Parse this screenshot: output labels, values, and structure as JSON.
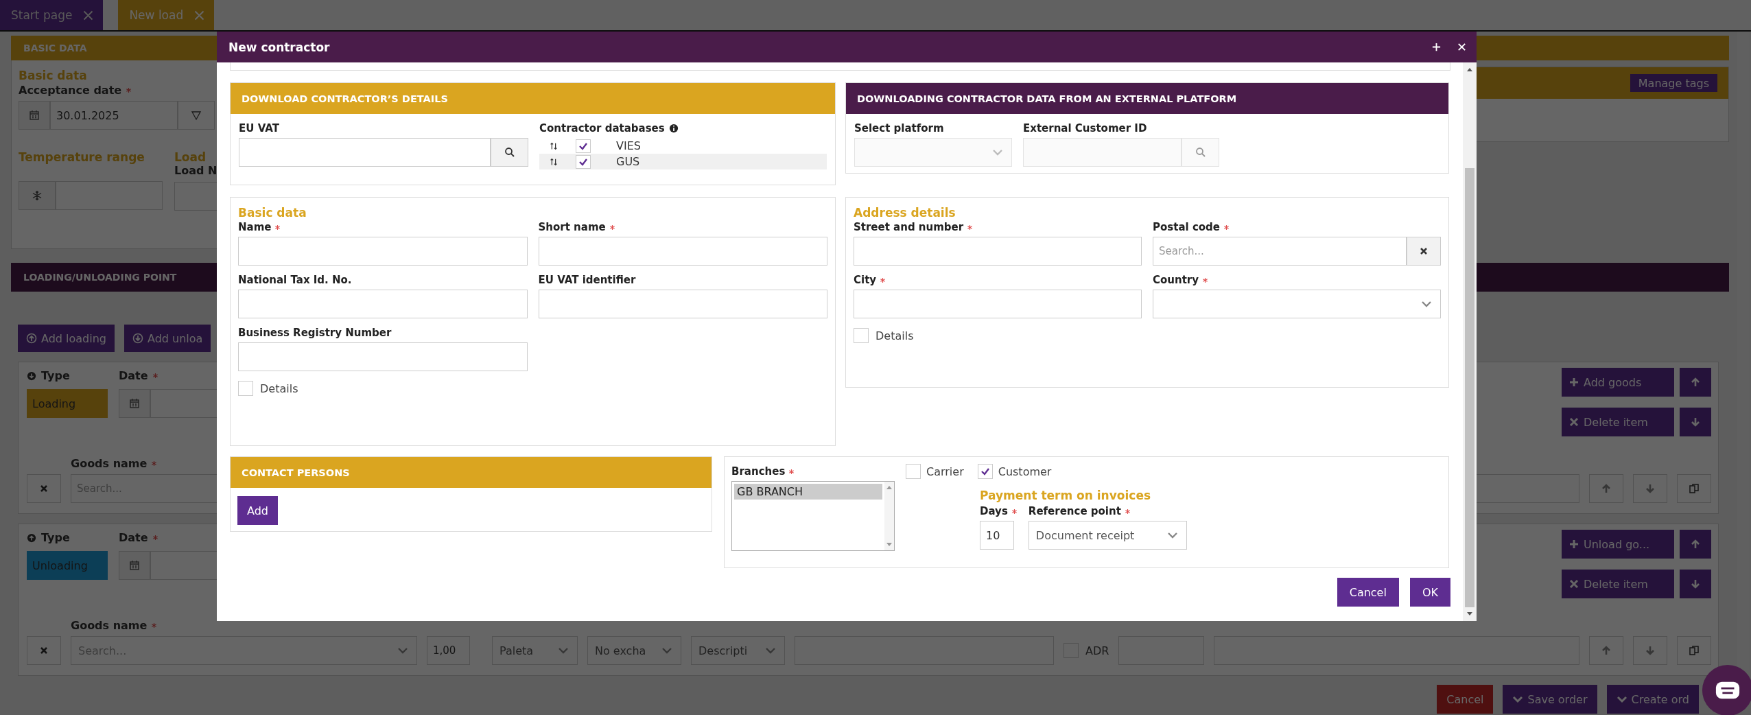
{
  "tabs": [
    {
      "label": "Start page",
      "selected": false
    },
    {
      "label": "New load",
      "selected": true
    }
  ],
  "basic_data_section": {
    "header": "BASIC DATA",
    "subtitle": "Basic data",
    "acceptance_label": "Acceptance date",
    "acceptance_required": true,
    "acceptance_value": "30.01.2025",
    "temperature_label": "Temperature range",
    "load_title": "Load",
    "load_label": "Load N",
    "manage_tags": "Manage tags"
  },
  "points_section": {
    "header": "LOADING/UNLOADING POINT",
    "add_buttons": [
      {
        "label": "Add loading",
        "kind": "loading"
      },
      {
        "label": "Add unloa",
        "kind": "unloading"
      }
    ],
    "items": [
      {
        "kind": "loading",
        "type_label": "Type",
        "type_value": "Loading",
        "date_label": "Date",
        "goods_label": "Goods name",
        "goods_placeholder": "Search...",
        "action_button": "Add goods",
        "delete_button": "Delete item"
      },
      {
        "kind": "unloading",
        "type_label": "Type",
        "type_value": "Unloading",
        "date_label": "Date",
        "goods_label": "Goods name",
        "goods_placeholder": "Search...",
        "action_button": "Unload go...",
        "delete_button": "Delete item",
        "quantity": "1,00",
        "unit": "Paleta",
        "exchange": "No excha",
        "description": "Descripti",
        "adr": {
          "label": "ADR",
          "checked": false
        }
      }
    ]
  },
  "footer_buttons": [
    {
      "label": "Cancel",
      "kind": "danger"
    },
    {
      "label": "Save order",
      "kind": "primary"
    },
    {
      "label": "Create ord",
      "kind": "primary"
    }
  ],
  "modal": {
    "title": "New contractor",
    "download_details": {
      "header": "DOWNLOAD CONTRACTOR’S DETAILS",
      "eu_vat_label": "EU VAT",
      "databases_label": "Contractor databases",
      "databases": [
        {
          "name": "VIES",
          "checked": true
        },
        {
          "name": "GUS",
          "checked": true
        }
      ]
    },
    "external_platform": {
      "header": "DOWNLOADING CONTRACTOR DATA FROM AN EXTERNAL PLATFORM",
      "platform_label": "Select platform",
      "customer_id_label": "External Customer ID"
    },
    "basic_data": {
      "title": "Basic data",
      "fields": [
        {
          "label": "Name",
          "required": true
        },
        {
          "label": "Short name",
          "required": true
        },
        {
          "label": "National Tax Id. No.",
          "required": false
        },
        {
          "label": "EU VAT identifier",
          "required": false
        },
        {
          "label": "Business Registry Number",
          "required": false
        }
      ],
      "details": {
        "label": "Details",
        "checked": false
      }
    },
    "address": {
      "title": "Address details",
      "fields": [
        {
          "label": "Street and number",
          "required": true,
          "kind": "text"
        },
        {
          "label": "Postal code",
          "required": true,
          "kind": "search",
          "placeholder": "Search..."
        },
        {
          "label": "City",
          "required": true,
          "kind": "text"
        },
        {
          "label": "Country",
          "required": true,
          "kind": "select"
        }
      ],
      "details": {
        "label": "Details",
        "checked": false
      }
    },
    "contact_persons": {
      "header": "CONTACT PERSONS",
      "add_button": "Add"
    },
    "branches": {
      "label": "Branches",
      "required": true,
      "options": [
        {
          "label": "GB BRANCH",
          "selected": true
        }
      ]
    },
    "roles": [
      {
        "label": "Carrier",
        "checked": false
      },
      {
        "label": "Customer",
        "checked": true
      }
    ],
    "payment_term": {
      "title": "Payment term on invoices",
      "days_label": "Days",
      "days_required": true,
      "days_value": "10",
      "reference_label": "Reference point",
      "reference_required": true,
      "reference_value": "Document receipt"
    },
    "buttons": [
      {
        "label": "Cancel"
      },
      {
        "label": "OK"
      }
    ]
  }
}
